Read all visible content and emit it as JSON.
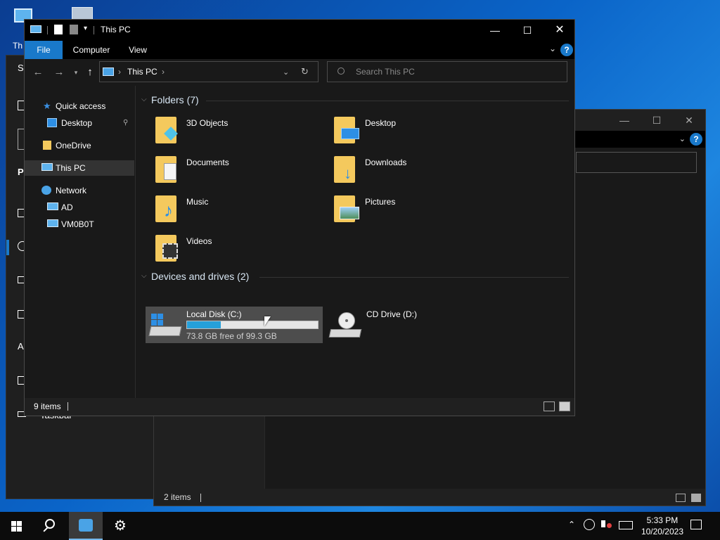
{
  "desktop": {
    "icon1_label": "Th",
    "settings_partial": [
      "Se",
      "P",
      "A"
    ],
    "taskbar_partial": "Taskbar"
  },
  "window": {
    "title": "This PC",
    "ribbon_tabs": [
      "File",
      "Computer",
      "View"
    ],
    "help": "?",
    "controls": {
      "minimize": "—",
      "maximize": "☐",
      "close": "✕"
    }
  },
  "address": {
    "breadcrumb": "This PC",
    "sep": "›",
    "search_placeholder": "Search This PC"
  },
  "nav": {
    "quick_access": "Quick access",
    "desktop": "Desktop",
    "onedrive": "OneDrive",
    "this_pc": "This PC",
    "network": "Network",
    "ad": "AD",
    "vm": "VM0B0T"
  },
  "folders_header": "Folders (7)",
  "folders": [
    {
      "name": "3D Objects",
      "icon": "3d-objects"
    },
    {
      "name": "Desktop",
      "icon": "desktop"
    },
    {
      "name": "Documents",
      "icon": "documents"
    },
    {
      "name": "Downloads",
      "icon": "downloads"
    },
    {
      "name": "Music",
      "icon": "music"
    },
    {
      "name": "Pictures",
      "icon": "pictures"
    },
    {
      "name": "Videos",
      "icon": "videos"
    }
  ],
  "drives_header": "Devices and drives (2)",
  "drives": [
    {
      "name": "Local Disk (C:)",
      "free": "73.8 GB free of 99.3 GB",
      "used_fraction": 0.257
    },
    {
      "name": "CD Drive (D:)"
    }
  ],
  "status": {
    "count": "9 items"
  },
  "back_window": {
    "status": "2 items"
  },
  "clock": {
    "time": "5:33 PM",
    "date": "10/20/2023"
  },
  "colors": {
    "accent": "#1979ca",
    "drive_bar": "#26a0da"
  }
}
